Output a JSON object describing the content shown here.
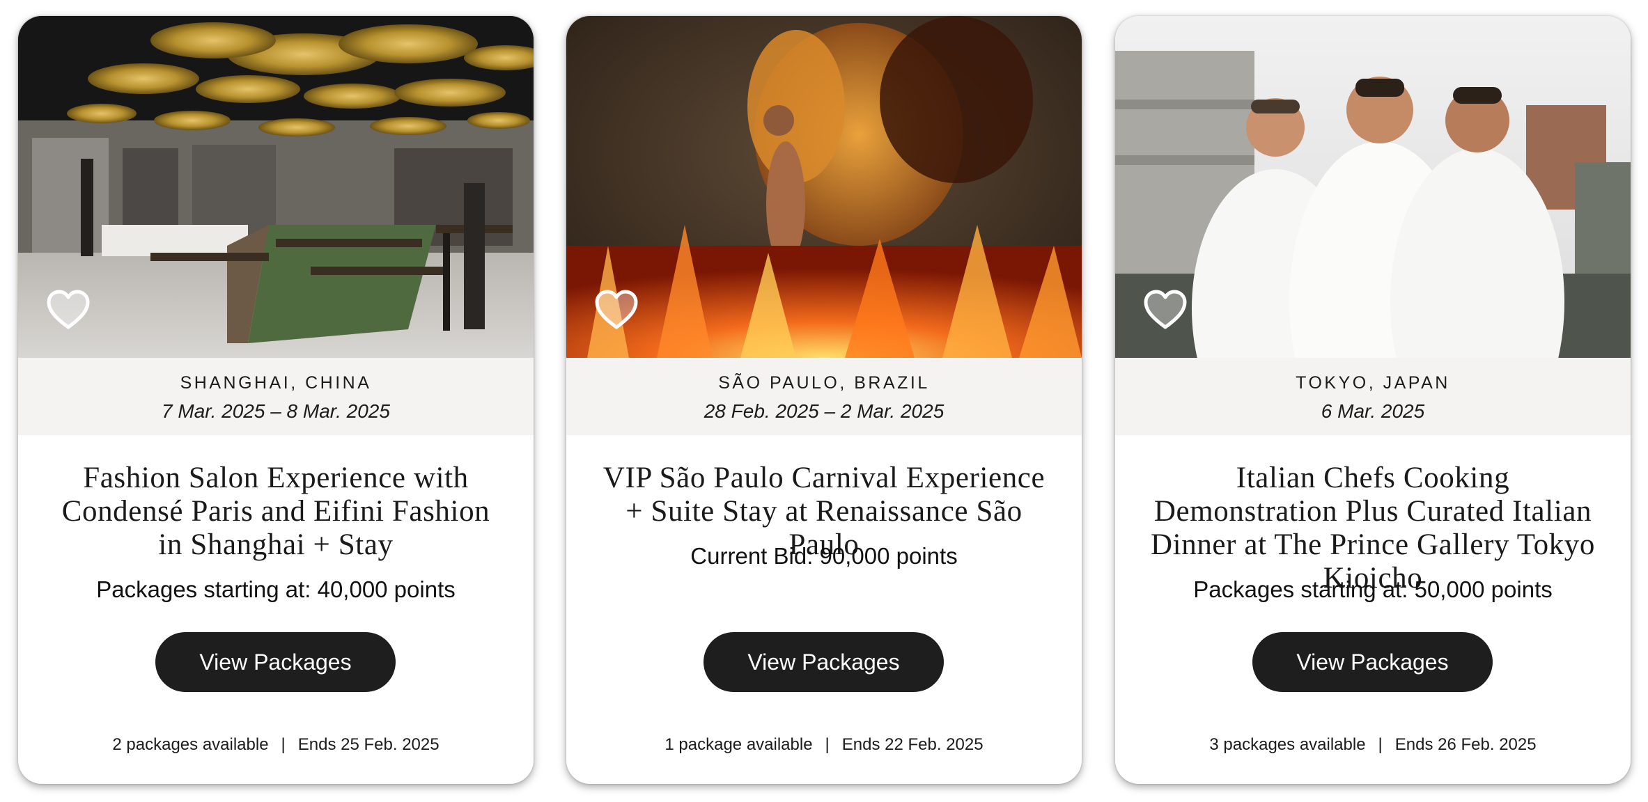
{
  "cards": [
    {
      "location": "SHANGHAI, CHINA",
      "dates": "7 Mar. 2025 – 8 Mar. 2025",
      "title": "Fashion Salon Experience with Condensé Paris and Eifini Fashion in Shanghai + Stay",
      "price": "Packages starting at: 40,000 points",
      "button": "View Packages",
      "packages": "2 packages available",
      "separator": "|",
      "ends": "Ends 25 Feb. 2025",
      "favorite_icon": "heart-outline-icon"
    },
    {
      "location": "SÃO PAULO, BRAZIL",
      "dates": "28 Feb. 2025 – 2 Mar. 2025",
      "title": "VIP São Paulo Carnival Experience + Suite Stay at Renaissance São Paulo",
      "price": "Current Bid: 90,000 points",
      "button": "View Packages",
      "packages": "1 package available",
      "separator": "|",
      "ends": "Ends 22 Feb. 2025",
      "favorite_icon": "heart-outline-icon"
    },
    {
      "location": "TOKYO, JAPAN",
      "dates": "6 Mar. 2025",
      "title": "Italian Chefs Cooking Demonstration Plus Curated Italian Dinner at The Prince Gallery Tokyo Kioicho",
      "price": "Packages starting at: 50,000 points",
      "button": "View Packages",
      "packages": "3 packages available",
      "separator": "|",
      "ends": "Ends 26 Feb. 2025",
      "favorite_icon": "heart-outline-icon"
    }
  ],
  "colors": {
    "button_bg": "#1e1e1e",
    "meta_band_bg": "#f4f3f1",
    "card_bg": "#ffffff"
  }
}
